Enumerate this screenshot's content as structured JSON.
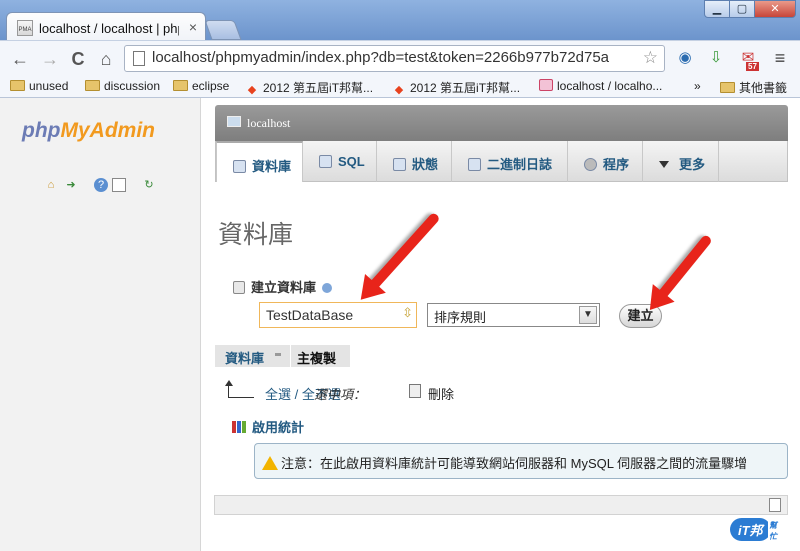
{
  "browser": {
    "tab_title": "localhost / localhost | php",
    "tab_close": "×",
    "favicon_text": "PMA",
    "window_controls": {
      "minimize": "▁",
      "maximize": "▢",
      "close": "✕"
    },
    "nav": {
      "back": "←",
      "forward": "→",
      "reload": "C",
      "home": "⌂"
    },
    "url": "localhost/phpmyadmin/index.php?db=test&token=2266b977b72d75a",
    "star": "☆",
    "extensions": [
      {
        "icon": "globe-icon",
        "glyph": "◉"
      },
      {
        "icon": "download-icon",
        "glyph": "⇩"
      },
      {
        "icon": "gmail-icon",
        "glyph": "✉"
      },
      {
        "icon": "menu-icon",
        "glyph": "≡"
      }
    ],
    "gmail_badge": "57",
    "bookmarks": [
      {
        "label": "unused",
        "type": "folder"
      },
      {
        "label": "discussion",
        "type": "folder"
      },
      {
        "label": "eclipse",
        "type": "folder"
      },
      {
        "label": "2012 第五屆iT邦幫...",
        "type": "it"
      },
      {
        "label": "2012 第五屆iT邦幫...",
        "type": "it"
      },
      {
        "label": "localhost / localho...",
        "type": "pma"
      }
    ],
    "bookmarks_overflow": "»",
    "other_bookmarks": "其他書籤"
  },
  "sidebar": {
    "logo_php": "php",
    "logo_myadmin": "MyAdmin",
    "icons": [
      "home-icon",
      "exit-icon",
      "help-icon",
      "docs-icon",
      "reload-icon"
    ]
  },
  "server": {
    "name": "localhost"
  },
  "tabs": [
    {
      "label": "資料庫",
      "icon": "database-icon",
      "active": true
    },
    {
      "label": "SQL",
      "icon": "sql-icon",
      "active": false
    },
    {
      "label": "狀態",
      "icon": "status-icon",
      "active": false
    },
    {
      "label": "二進制日誌",
      "icon": "binlog-icon",
      "active": false
    },
    {
      "label": "程序",
      "icon": "process-icon",
      "active": false
    },
    {
      "label": "更多",
      "icon": "caret-icon",
      "active": false
    }
  ],
  "page": {
    "title": "資料庫",
    "create": {
      "header": "建立資料庫",
      "db_name_value": "TestDataBase",
      "collation_value": "排序規則",
      "collation_arrow": "▼",
      "button": "建立"
    },
    "subtabs": {
      "databases": "資料庫",
      "master_replication": "主複製"
    },
    "selection": {
      "check_all": "全選 / 全不選",
      "with_selected": "選中項：",
      "delete": "刪除"
    },
    "stats": {
      "header": "啟用統計",
      "notice": "注意：在此啟用資料庫統計可能導致網站伺服器和 MySQL 伺服器之間的流量驟增"
    }
  },
  "watermark": {
    "text": "iT邦",
    "sub": "幫忙"
  },
  "colors": {
    "accent_link": "#235a81",
    "logo_php": "#6c7cb5",
    "logo_admin": "#f29a1f",
    "arrow": "#e8241a",
    "input_border": "#f0b75a"
  }
}
